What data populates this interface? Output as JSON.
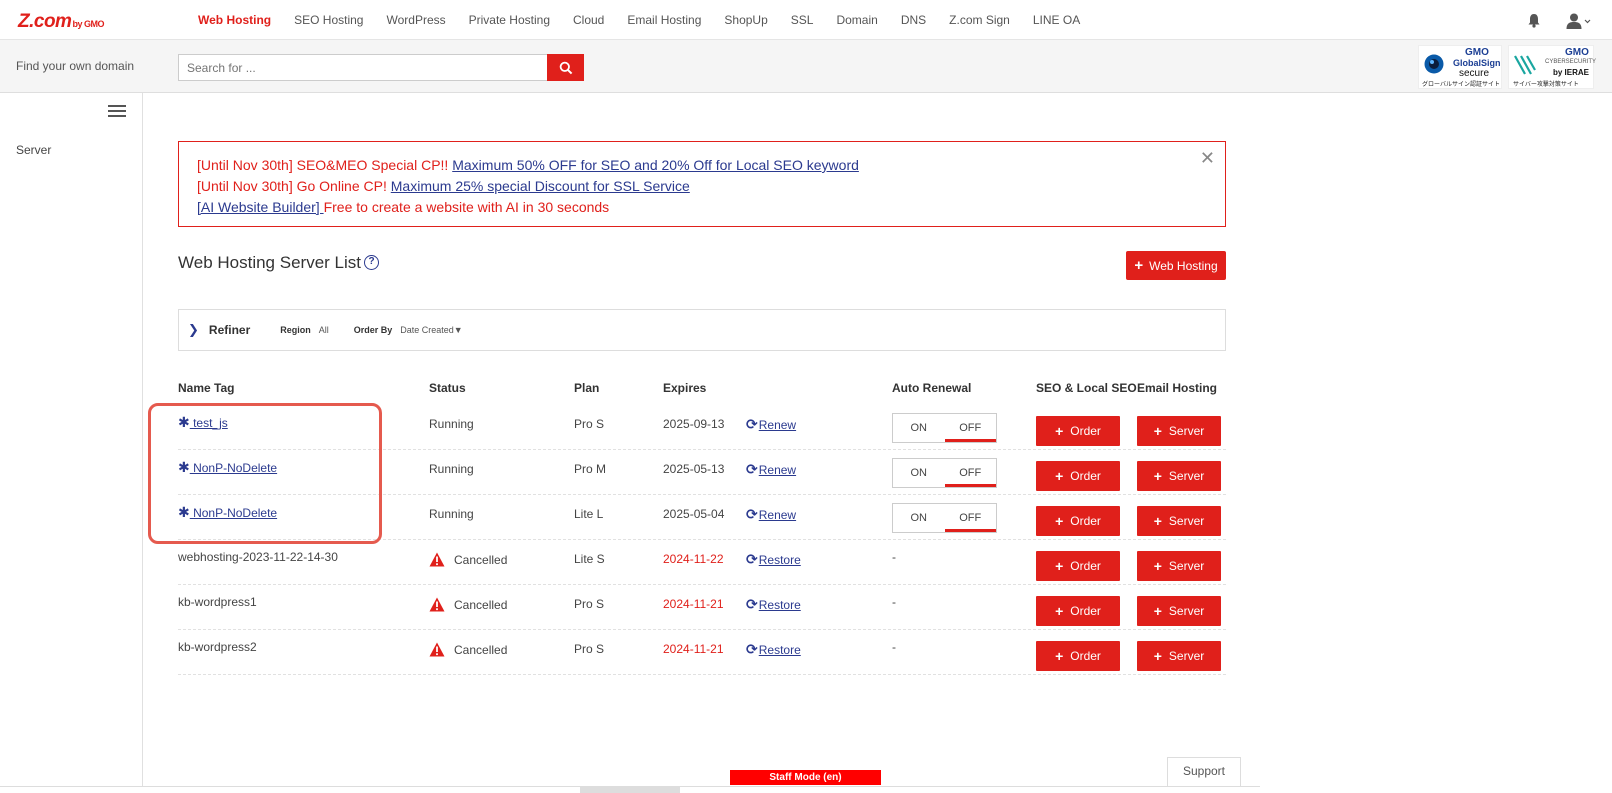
{
  "nav": {
    "logo": "Z.com",
    "logo_by": "by GMO",
    "items": [
      "Web Hosting",
      "SEO Hosting",
      "WordPress",
      "Private Hosting",
      "Cloud",
      "Email Hosting",
      "ShopUp",
      "SSL",
      "Domain",
      "DNS",
      "Z.com Sign",
      "LINE OA"
    ],
    "active": "Web Hosting"
  },
  "search": {
    "label": "Find your own domain",
    "placeholder": "Search for ..."
  },
  "badges": {
    "globalsign": {
      "l1": "GMO",
      "l2": "GlobalSign",
      "l3": "secure",
      "l4": "グローバルサイン認証サイト"
    },
    "ierae": {
      "l1": "GMO",
      "l2": "CYBERSECURITY",
      "l3": "by IERAE",
      "l4": "サイバー攻撃対策サイト"
    }
  },
  "sidebar": {
    "items": [
      "Server"
    ]
  },
  "notice": {
    "line1_prefix": "[Until Nov 30th] SEO&MEO Special CP!! ",
    "line1_link": "Maximum 50% OFF for SEO and 20% Off for Local SEO keyword",
    "line2_prefix": "[Until Nov 30th] Go Online CP! ",
    "line2_link": "Maximum 25% special Discount for SSL Service",
    "line3_link": "[AI Website Builder] ",
    "line3_suffix": "Free to create a website with AI in 30 seconds",
    "close": "✕"
  },
  "page": {
    "title": "Web Hosting Server List",
    "help": "?",
    "add_button": "Web Hosting"
  },
  "refiner": {
    "title": "Refiner",
    "region_label": "Region",
    "region_value": "All",
    "order_label": "Order By",
    "order_value": "Date Created▼"
  },
  "table": {
    "headers": [
      "Name Tag",
      "Status",
      "Plan",
      "Expires",
      "Auto Renewal",
      "SEO & Local SEO",
      "Email Hosting"
    ],
    "rows": [
      {
        "name": " test_js",
        "status": "Running",
        "plan": "Pro S",
        "expires": "2025-09-13",
        "action": "Renew",
        "toggle_on": "ON",
        "toggle_off": "OFF",
        "order": "Order",
        "server": "Server"
      },
      {
        "name": " NonP-NoDelete",
        "status": "Running",
        "plan": "Pro M",
        "expires": "2025-05-13",
        "action": "Renew",
        "toggle_on": "ON",
        "toggle_off": "OFF",
        "order": "Order",
        "server": "Server"
      },
      {
        "name": " NonP-NoDelete",
        "status": "Running",
        "plan": "Lite L",
        "expires": "2025-05-04",
        "action": "Renew",
        "toggle_on": "ON",
        "toggle_off": "OFF",
        "order": "Order",
        "server": "Server"
      },
      {
        "name": "webhosting-2023-11-22-14-30",
        "status": "Cancelled",
        "plan": "Lite S",
        "expires": "2024-11-22",
        "action": "Restore",
        "renewal": "-",
        "order": "Order",
        "server": "Server"
      },
      {
        "name": "kb-wordpress1",
        "status": "Cancelled",
        "plan": "Pro S",
        "expires": "2024-11-21",
        "action": "Restore",
        "renewal": "-",
        "order": "Order",
        "server": "Server"
      },
      {
        "name": "kb-wordpress2",
        "status": "Cancelled",
        "plan": "Pro S",
        "expires": "2024-11-21",
        "action": "Restore",
        "renewal": "-",
        "order": "Order",
        "server": "Server"
      }
    ]
  },
  "footer": {
    "staff_mode": "Staff Mode (en)",
    "support": "Support"
  },
  "colors": {
    "accent": "#e0201b",
    "link": "#2b3a8f"
  }
}
